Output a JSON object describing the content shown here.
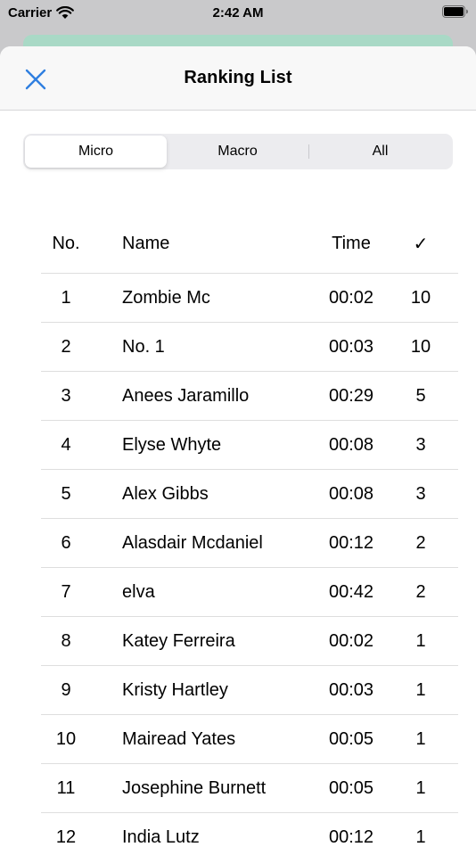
{
  "status": {
    "carrier": "Carrier",
    "time": "2:42 AM"
  },
  "nav": {
    "title": "Ranking List"
  },
  "segments": [
    {
      "label": "Micro",
      "active": true
    },
    {
      "label": "Macro",
      "active": false
    },
    {
      "label": "All",
      "active": false
    }
  ],
  "table": {
    "headers": {
      "no": "No.",
      "name": "Name",
      "time": "Time",
      "count": "✓"
    },
    "rows": [
      {
        "no": "1",
        "name": "Zombie Mc",
        "time": "00:02",
        "count": "10"
      },
      {
        "no": "2",
        "name": "No. 1",
        "time": "00:03",
        "count": "10"
      },
      {
        "no": "3",
        "name": "Anees Jaramillo",
        "time": "00:29",
        "count": "5"
      },
      {
        "no": "4",
        "name": "Elyse Whyte",
        "time": "00:08",
        "count": "3"
      },
      {
        "no": "5",
        "name": "Alex Gibbs",
        "time": "00:08",
        "count": "3"
      },
      {
        "no": "6",
        "name": "Alasdair Mcdaniel",
        "time": "00:12",
        "count": "2"
      },
      {
        "no": "7",
        "name": "elva",
        "time": "00:42",
        "count": "2"
      },
      {
        "no": "8",
        "name": "Katey Ferreira",
        "time": "00:02",
        "count": "1"
      },
      {
        "no": "9",
        "name": "Kristy Hartley",
        "time": "00:03",
        "count": "1"
      },
      {
        "no": "10",
        "name": "Mairead Yates",
        "time": "00:05",
        "count": "1"
      },
      {
        "no": "11",
        "name": "Josephine Burnett",
        "time": "00:05",
        "count": "1"
      },
      {
        "no": "12",
        "name": "India Lutz",
        "time": "00:12",
        "count": "1"
      }
    ]
  },
  "colors": {
    "accent": "#2f7fe0",
    "peek": "#a9d9c6",
    "segment_bg": "#ececef"
  },
  "icons": {
    "close": "close-icon",
    "wifi": "wifi-icon",
    "battery": "battery-icon"
  }
}
